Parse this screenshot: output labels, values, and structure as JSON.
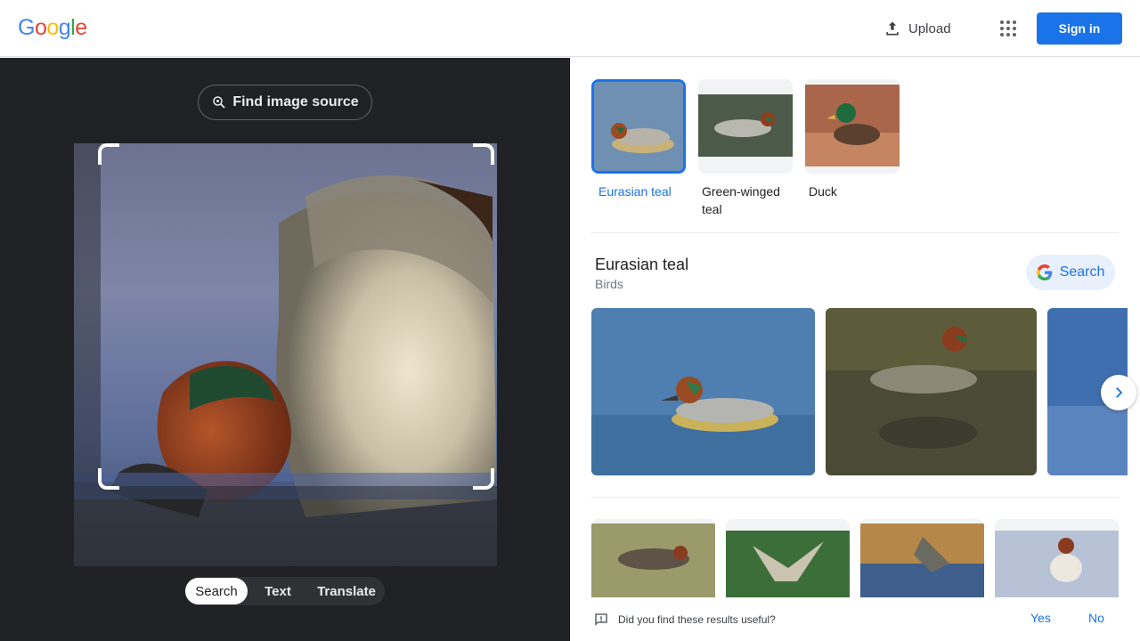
{
  "header": {
    "logo": [
      "G",
      "o",
      "o",
      "g",
      "l",
      "e"
    ],
    "logo_colors": [
      "#4285F4",
      "#EA4335",
      "#FBBC05",
      "#4285F4",
      "#34A853",
      "#EA4335"
    ],
    "upload_label": "Upload",
    "apps_icon": "apps-grid-icon",
    "signin_label": "Sign in"
  },
  "viewer": {
    "find_source_label": "Find image source",
    "tabs": [
      {
        "label": "Search",
        "active": true
      },
      {
        "label": "Text",
        "active": false
      },
      {
        "label": "Translate",
        "active": false
      }
    ]
  },
  "results": {
    "chips": [
      {
        "label": "Eurasian teal",
        "selected": true
      },
      {
        "label": "Green-winged teal",
        "selected": false
      },
      {
        "label": "Duck",
        "selected": false
      }
    ],
    "entity_title": "Eurasian teal",
    "entity_subtitle": "Birds",
    "search_label": "Search",
    "feedback_question": "Did you find these results useful?",
    "feedback_yes": "Yes",
    "feedback_no": "No"
  },
  "colors": {
    "accent": "#1a73e8",
    "viewer_bg": "#202124"
  }
}
